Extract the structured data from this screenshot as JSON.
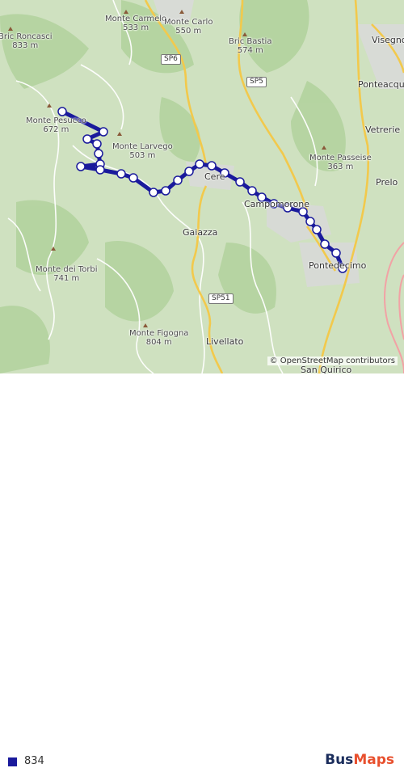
{
  "colors": {
    "route": "#1a1a9c",
    "background": "#cfe1c0",
    "forest": "#a9cc95",
    "road_main": "#f2c94c",
    "road_minor": "#ffffff",
    "river": "#f2a2a5",
    "brand_bus": "#1b2d5c",
    "brand_maps": "#e8502e"
  },
  "map": {
    "places": {
      "roncasci": "Bric Roncasci",
      "roncasci_elev": "833 m",
      "carmelo": "Monte Carmelo",
      "carmelo_elev": "533 m",
      "carlo": "Monte Carlo",
      "carlo_elev": "550 m",
      "bastia": "Bric Bastia",
      "bastia_elev": "574 m",
      "visegno": "Visegno",
      "ponteacqua": "Ponteacqua",
      "pesucco": "Monte Pesucco",
      "pesucco_elev": "672 m",
      "larvego": "Monte Larvego",
      "larvego_elev": "503 m",
      "vetrerie": "Vetrerie",
      "passeise": "Monte Passeise",
      "passeise_elev": "363 m",
      "prelo": "Prelo",
      "cere": "Cere",
      "campomorone": "Campomorone",
      "gaiazza": "Gaiazza",
      "pontedecimo": "Pontedecimo",
      "torbi": "Monte dei Torbi",
      "torbi_elev": "741 m",
      "figogna": "Monte Figogna",
      "figogna_elev": "804 m",
      "livellato": "Livellato",
      "san_quirico": "San Quirico"
    },
    "shields": {
      "sp6": "SP6",
      "sp5": "SP5",
      "sp51": "SP51"
    },
    "attribution": "© OpenStreetMap contributors"
  },
  "legend": {
    "route_name": "834",
    "route_color": "#1a1a9c"
  },
  "brand": {
    "bus": "Bus",
    "maps": "Maps"
  }
}
